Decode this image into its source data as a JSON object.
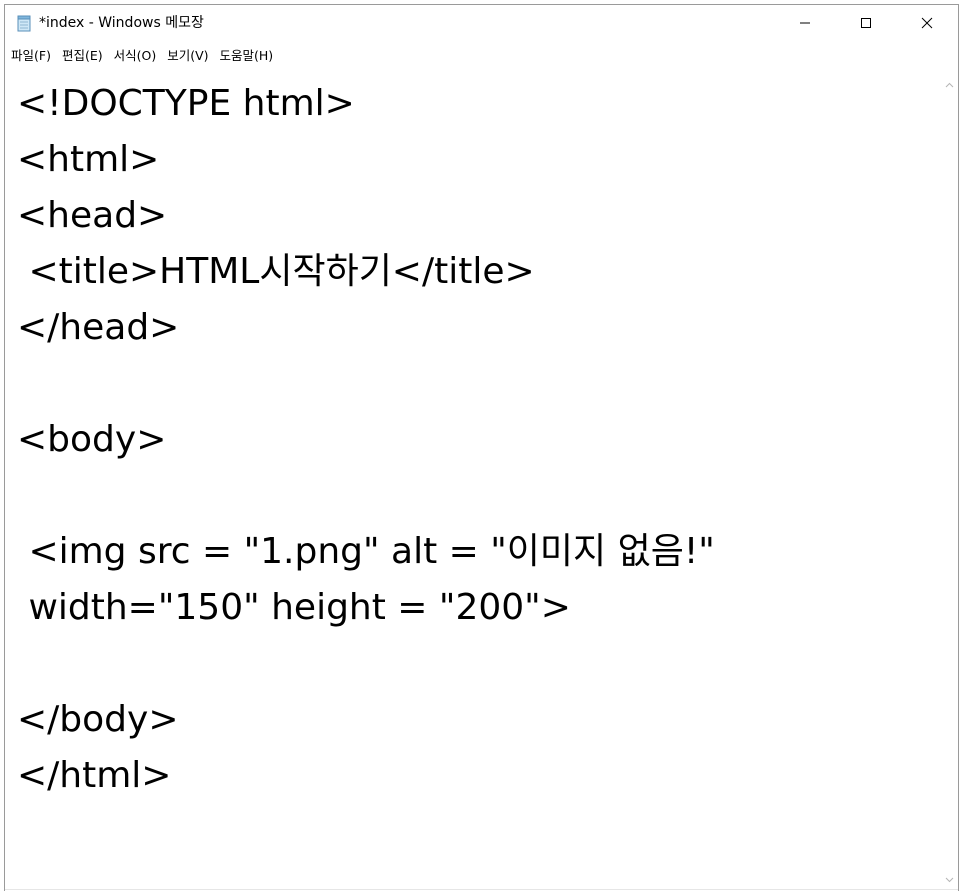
{
  "window": {
    "title": "*index - Windows 메모장",
    "icon": "notepad-icon"
  },
  "controls": {
    "minimize_icon": "minimize-icon",
    "maximize_icon": "maximize-icon",
    "close_icon": "close-icon"
  },
  "menu": {
    "items": [
      {
        "label": "파일(F)"
      },
      {
        "label": "편집(E)"
      },
      {
        "label": "서식(O)"
      },
      {
        "label": "보기(V)"
      },
      {
        "label": "도움말(H)"
      }
    ]
  },
  "editor": {
    "lines": [
      "<!DOCTYPE html>",
      "<html>",
      "<head>",
      " <title>HTML시작하기</title>",
      "</head>",
      "",
      "<body>",
      "",
      " <img src = \"1.png\" alt = \"이미지 없음!\"",
      " width=\"150\" height = \"200\">",
      "",
      "</body>",
      "</html>"
    ]
  },
  "scrollbar": {
    "up_icon": "chevron-up-icon",
    "down_icon": "chevron-down-icon"
  }
}
